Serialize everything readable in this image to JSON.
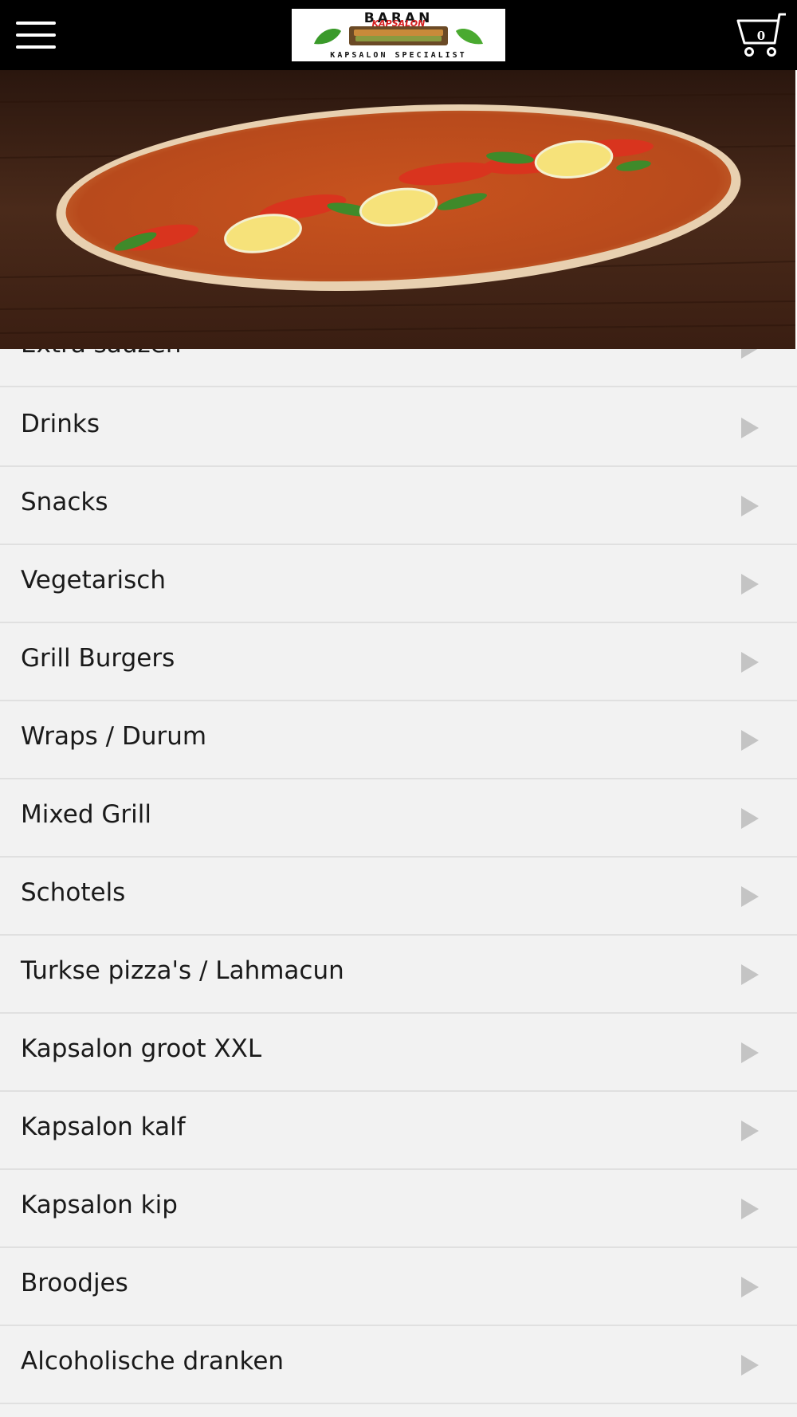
{
  "header": {
    "menu_icon": "hamburger-menu-icon",
    "logo": {
      "brand_name": "BARAN",
      "sub_brand": "KAPSALON",
      "tagline": "KAPSALON SPECIALIST"
    },
    "cart_icon": "shopping-cart-icon",
    "cart_count": "0"
  },
  "hero": {
    "image_subject": "lahmacun"
  },
  "categories": [
    {
      "label": "Extra sauzen",
      "icon": "chevron-right-icon"
    },
    {
      "label": "Drinks",
      "icon": "chevron-right-icon"
    },
    {
      "label": "Snacks",
      "icon": "chevron-right-icon"
    },
    {
      "label": "Vegetarisch",
      "icon": "chevron-right-icon"
    },
    {
      "label": "Grill Burgers",
      "icon": "chevron-right-icon"
    },
    {
      "label": "Wraps / Durum",
      "icon": "chevron-right-icon"
    },
    {
      "label": "Mixed Grill",
      "icon": "chevron-right-icon"
    },
    {
      "label": "Schotels",
      "icon": "chevron-right-icon"
    },
    {
      "label": "Turkse pizza's / Lahmacun",
      "icon": "chevron-right-icon"
    },
    {
      "label": "Kapsalon groot XXL",
      "icon": "chevron-right-icon"
    },
    {
      "label": "Kapsalon kalf",
      "icon": "chevron-right-icon"
    },
    {
      "label": "Kapsalon kip",
      "icon": "chevron-right-icon"
    },
    {
      "label": "Broodjes",
      "icon": "chevron-right-icon"
    },
    {
      "label": "Alcoholische dranken",
      "icon": "chevron-right-icon"
    }
  ],
  "colors": {
    "header_bg": "#000000",
    "list_bg": "#f2f2f2",
    "divider": "#e0e0e0",
    "arrow": "#c4c4c4",
    "text": "#1a1a1a"
  }
}
